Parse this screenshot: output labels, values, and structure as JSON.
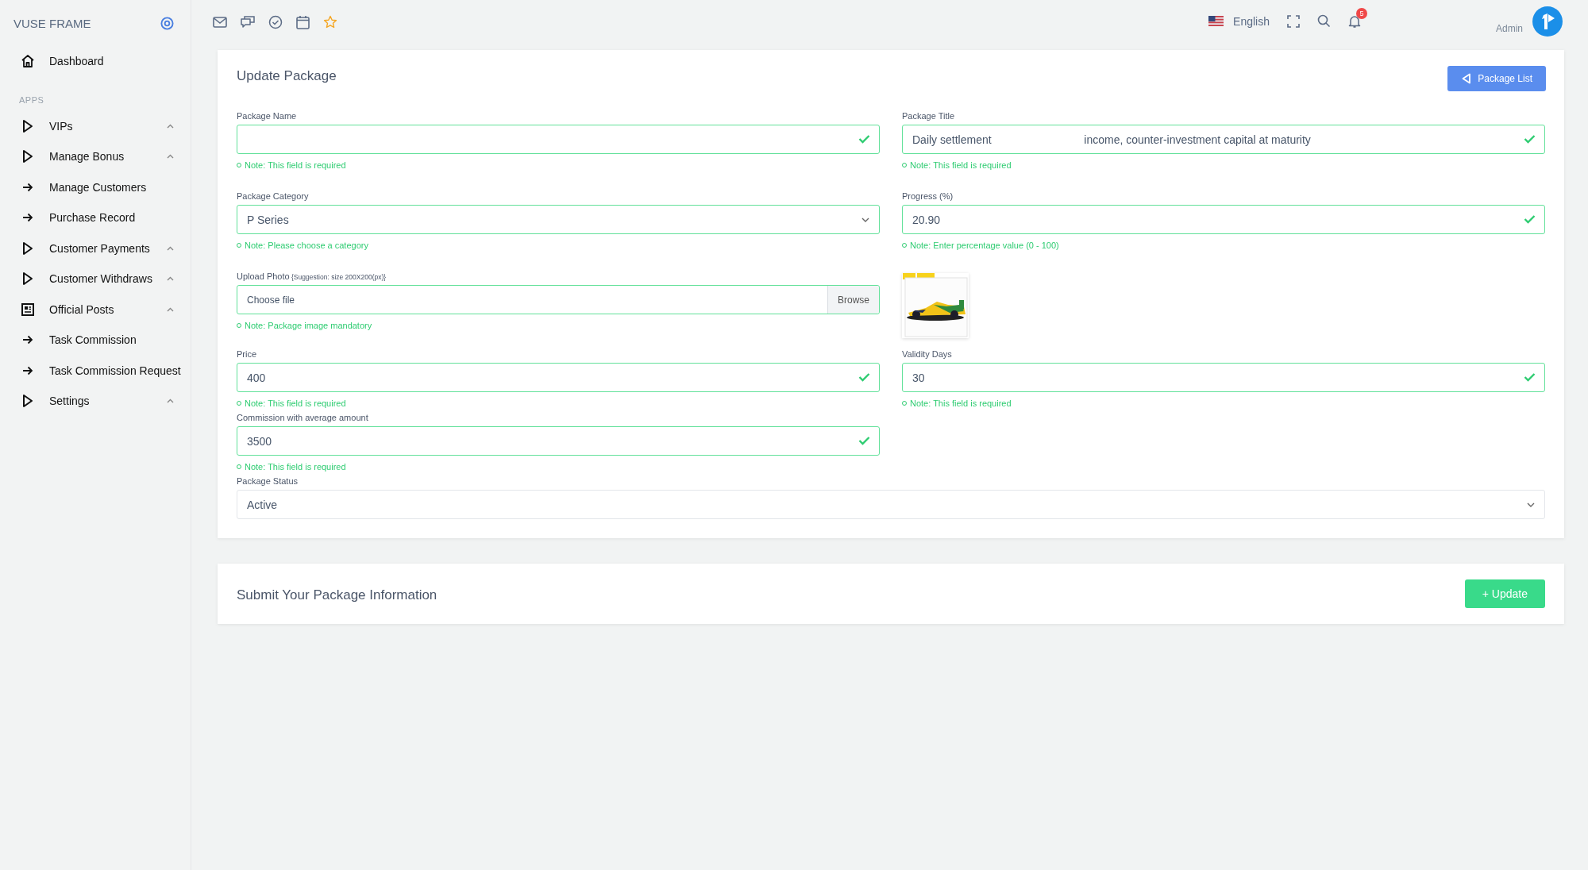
{
  "sidebar": {
    "brand": "VUSE FRAME",
    "dashboard": "Dashboard",
    "section": "APPS",
    "items": [
      {
        "label": "VIPs",
        "kind": "group",
        "expandable": true
      },
      {
        "label": "Manage Bonus",
        "kind": "group",
        "expandable": true
      },
      {
        "label": "Manage Customers",
        "kind": "link",
        "expandable": false
      },
      {
        "label": "Purchase Record",
        "kind": "link",
        "expandable": false
      },
      {
        "label": "Customer Payments",
        "kind": "group",
        "expandable": true
      },
      {
        "label": "Customer Withdraws",
        "kind": "group",
        "expandable": true
      },
      {
        "label": "Official Posts",
        "kind": "posts",
        "expandable": true
      },
      {
        "label": "Task Commission",
        "kind": "link",
        "expandable": false
      },
      {
        "label": "Task Commission Request",
        "kind": "link",
        "expandable": false
      },
      {
        "label": "Settings",
        "kind": "group",
        "expandable": true
      }
    ]
  },
  "topbar": {
    "language": "English",
    "notifications": "5",
    "user": "Admin"
  },
  "form": {
    "title": "Update Package",
    "list_button": "Package List",
    "rows": [
      [
        {
          "kind": "text",
          "label": "Package Name",
          "valid": true,
          "note": "Note: This field is required"
        },
        {
          "kind": "text",
          "label": "Package Title",
          "value": "Daily settlement                              income, counter-investment capital at maturity",
          "valid": true,
          "note": "Note: This field is required"
        }
      ],
      [
        {
          "kind": "select",
          "label": "Package Category",
          "value": "P Series",
          "valid": true,
          "note": "Note: Please choose a category"
        },
        {
          "kind": "text",
          "label": "Progress (%)",
          "value": "20.90",
          "valid": true,
          "note": "Note: Enter percentage value (0 - 100)"
        }
      ],
      [
        {
          "kind": "file",
          "label": "Upload Photo",
          "hint": "{Suggestion: size 200X200(px)}",
          "placeholder": "Choose file",
          "button": "Browse",
          "valid": true,
          "note": "Note: Package image mandatory"
        },
        {
          "kind": "preview"
        }
      ],
      [
        {
          "kind": "text",
          "label": "Price",
          "value": "400",
          "valid": true,
          "note": "Note: This field is required"
        },
        {
          "kind": "text",
          "label": "Validity Days",
          "value": "30",
          "valid": true,
          "note": "Note: This field is required"
        }
      ],
      [
        {
          "kind": "text",
          "label": "Commission with average amount",
          "value": "3500",
          "valid": true,
          "note": "Note: This field is required"
        }
      ],
      [
        {
          "kind": "select",
          "label": "Package Status",
          "value": "Active",
          "valid": false,
          "full": true
        }
      ]
    ]
  },
  "submit": {
    "title": "Submit Your Package Information",
    "button": "+ Update"
  }
}
